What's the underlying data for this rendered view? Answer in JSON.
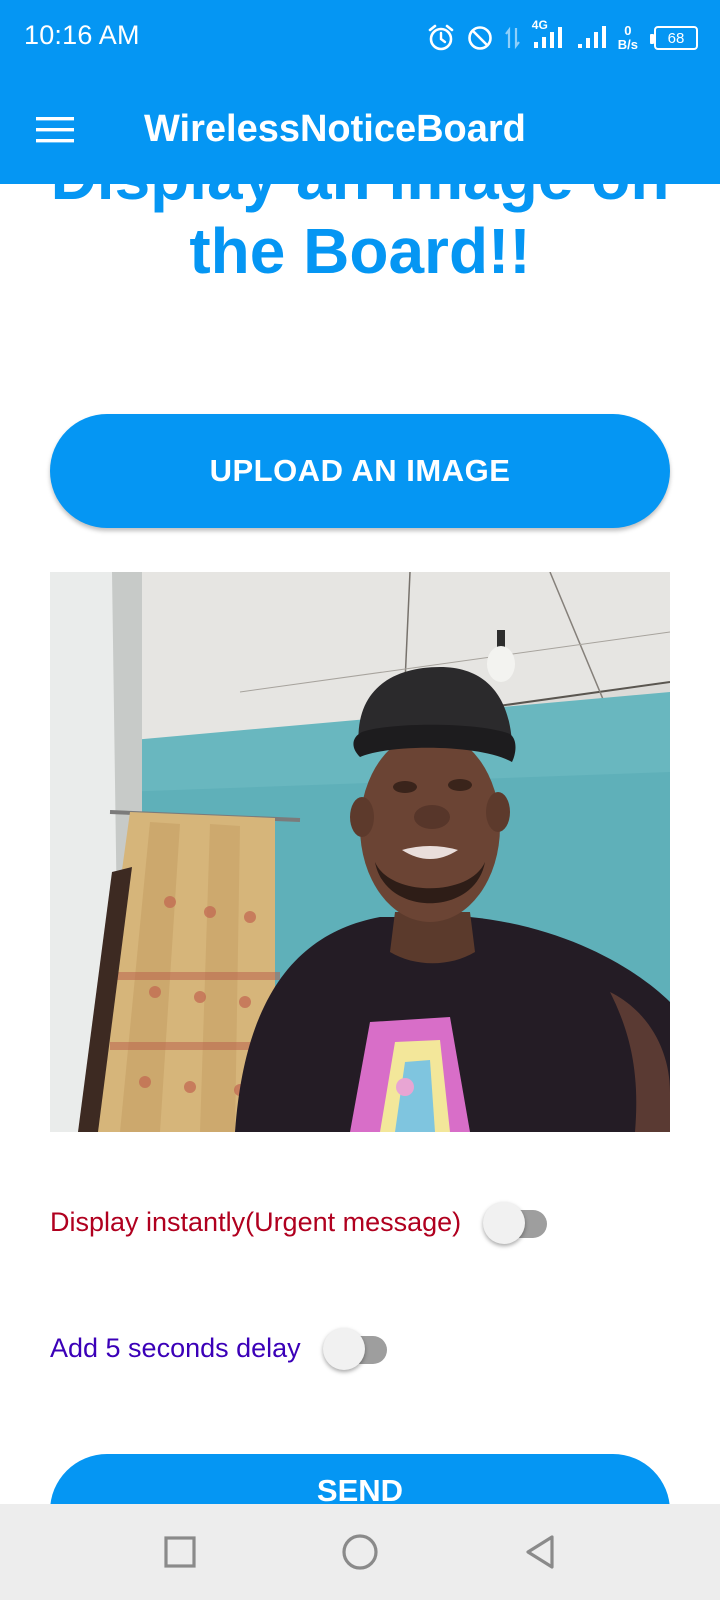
{
  "status_bar": {
    "time": "10:16 AM",
    "network_type": "4G",
    "net_speed_value": "0",
    "net_speed_unit": "B/s",
    "battery_level": "68",
    "icons": [
      "alarm-icon",
      "do-not-disturb-icon",
      "data-transfer-icon",
      "signal-4g-icon",
      "signal-icon",
      "battery-icon"
    ]
  },
  "app_bar": {
    "title": "WirelessNoticeBoard",
    "menu_icon": "hamburger-menu-icon"
  },
  "main": {
    "heading": "Display an image on the Board!!",
    "upload_button_label": "UPLOAD AN IMAGE",
    "toggles": [
      {
        "label": "Display instantly(Urgent message)",
        "checked": false,
        "color": "#b0001f"
      },
      {
        "label": "Add 5 seconds delay",
        "checked": false,
        "color": "#3b00b8"
      }
    ],
    "send_button_label": "SEND"
  },
  "nav_bar": {
    "icons": [
      "recents-square-icon",
      "home-circle-icon",
      "back-triangle-icon"
    ]
  },
  "colors": {
    "accent": "#0596f3",
    "background": "#ffffff",
    "nav_bar_bg": "#ededed"
  }
}
